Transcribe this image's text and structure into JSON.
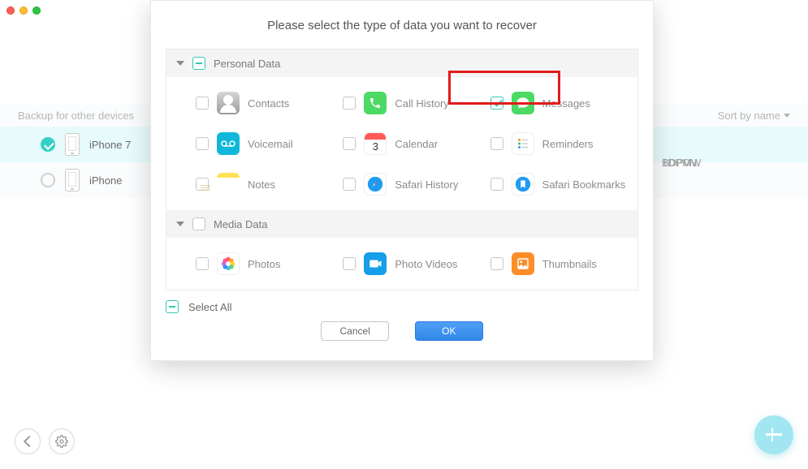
{
  "window": {
    "title": ""
  },
  "sidebar": {
    "header_label": "Backup for other devices",
    "sort_label": "Sort by name",
    "devices": [
      {
        "name": "iPhone 7",
        "serial": "BDP0N",
        "selected": true
      },
      {
        "name": "iPhone",
        "serial": "1DPMW",
        "selected": false
      }
    ]
  },
  "dialog": {
    "title": "Please select the type of data you want to recover",
    "categories": [
      {
        "name": "Personal Data",
        "state": "indeterminate",
        "items": [
          {
            "key": "contacts",
            "label": "Contacts",
            "checked": false,
            "icon": "contacts-icon"
          },
          {
            "key": "call_history",
            "label": "Call History",
            "checked": false,
            "icon": "phone-icon"
          },
          {
            "key": "messages",
            "label": "Messages",
            "checked": true,
            "icon": "messages-icon",
            "highlighted": true
          },
          {
            "key": "voicemail",
            "label": "Voicemail",
            "checked": false,
            "icon": "voicemail-icon"
          },
          {
            "key": "calendar",
            "label": "Calendar",
            "checked": false,
            "icon": "calendar-icon"
          },
          {
            "key": "reminders",
            "label": "Reminders",
            "checked": false,
            "icon": "reminders-icon"
          },
          {
            "key": "notes",
            "label": "Notes",
            "checked": false,
            "icon": "notes-icon"
          },
          {
            "key": "safari_hist",
            "label": "Safari History",
            "checked": false,
            "icon": "safari-icon"
          },
          {
            "key": "safari_bm",
            "label": "Safari Bookmarks",
            "checked": false,
            "icon": "safari-bookmarks-icon"
          }
        ]
      },
      {
        "name": "Media Data",
        "state": "unchecked",
        "items": [
          {
            "key": "photos",
            "label": "Photos",
            "checked": false,
            "icon": "photos-icon"
          },
          {
            "key": "photo_videos",
            "label": "Photo Videos",
            "checked": false,
            "icon": "photo-videos-icon"
          },
          {
            "key": "thumbnails",
            "label": "Thumbnails",
            "checked": false,
            "icon": "thumbnails-icon"
          }
        ]
      }
    ],
    "select_all_label": "Select All",
    "select_all_state": "indeterminate",
    "cancel_label": "Cancel",
    "ok_label": "OK"
  }
}
